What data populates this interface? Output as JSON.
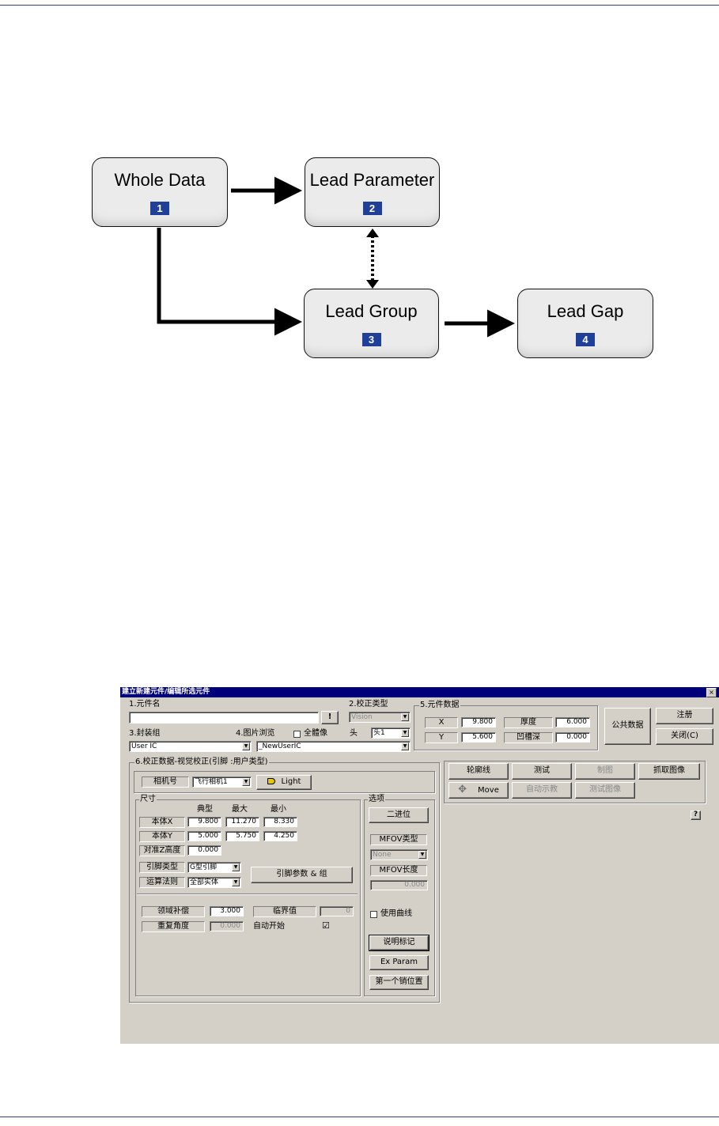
{
  "diagram": {
    "nodes": [
      {
        "title": "Whole Data",
        "num": "1"
      },
      {
        "title": "Lead Parameter",
        "num": "2"
      },
      {
        "title": "Lead Group",
        "num": "3"
      },
      {
        "title": "Lead Gap",
        "num": "4"
      }
    ]
  },
  "dialog": {
    "title": "建立新建元件/编辑所选元件",
    "close": "×",
    "f1_label": "1.元件名",
    "f1_button": "!",
    "f2_label": "2.校正类型",
    "f2_value": "Vision",
    "f3_label": "3.封装组",
    "f3_value": "User IC",
    "f4_label": "4.图片浏览",
    "f4_check": "全體像",
    "f4_head_label": "头",
    "f4_head_value": "头1",
    "f4_value": "_NewUserIC",
    "f5": {
      "label": "5.元件数据",
      "x_label": "X",
      "x_value": "9.800",
      "y_label": "Y",
      "y_value": "5.600",
      "thick_label": "厚度",
      "thick_value": "6.000",
      "recess_label": "凹槽深",
      "recess_value": "0.000"
    },
    "buttons_right": {
      "public": "公共数据",
      "register": "注册",
      "close": "关闭(C)"
    },
    "f6": {
      "label": "6.校正数据-视觉校正(引脚 :用户类型)",
      "camera_label": "相机号",
      "camera_value": "飞行相机1",
      "light": "Light",
      "size": {
        "label": "尺寸",
        "col_typ": "典型",
        "col_max": "最大",
        "col_min": "最小",
        "body_x": {
          "label": "本体X",
          "typ": "9.800",
          "max": "11.270",
          "min": "8.330"
        },
        "body_y": {
          "label": "本体Y",
          "typ": "5.000",
          "max": "5.750",
          "min": "4.250"
        },
        "align_z": {
          "label": "对准Z高度",
          "value": "0.000"
        },
        "lead_type": {
          "label": "引脚类型",
          "value": "G型引脚"
        },
        "algo": {
          "label": "运算法则",
          "value": "全部实体"
        },
        "lead_param_btn": "引脚参数 & 组",
        "comp": {
          "label": "领域补偿",
          "value": "3.000"
        },
        "threshold": {
          "label": "临界值",
          "value": "0"
        },
        "repeat": {
          "label": "重复角度",
          "value": "0.000"
        },
        "auto_start": "自动开始",
        "auto_start_mark": "☑"
      },
      "options": {
        "label": "选项",
        "binary": "二进位",
        "mfov_type_label": "MFOV类型",
        "mfov_type_value": "None",
        "mfov_len_label": "MFOV长度",
        "mfov_len_value": "0.000",
        "use_curve": "使用曲线",
        "desc_mark": "说明标记",
        "ex_param": "Ex Param",
        "first_pin": "第一个销位置"
      }
    },
    "toolbar": {
      "contour": "轮廓线",
      "test": "测试",
      "draw": "制图",
      "grab": "抓取图像",
      "move": "Move",
      "autoteach": "自动示教",
      "test_image": "测试图像",
      "move_icon": "✥"
    },
    "help": "?"
  }
}
